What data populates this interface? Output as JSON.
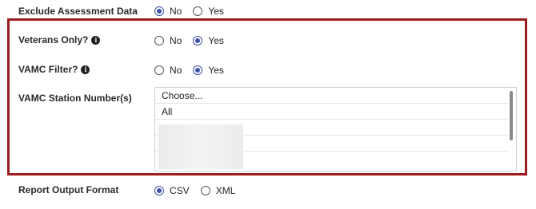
{
  "exclude_assessment": {
    "label": "Exclude Assessment Data",
    "options": [
      "No",
      "Yes"
    ],
    "selected": "No"
  },
  "veterans_only": {
    "label": "Veterans Only?",
    "options": [
      "No",
      "Yes"
    ],
    "selected": "Yes"
  },
  "vamc_filter": {
    "label": "VAMC Filter?",
    "options": [
      "No",
      "Yes"
    ],
    "selected": "Yes"
  },
  "vamc_station": {
    "label": "VAMC Station Number(s)",
    "items": [
      "Choose...",
      "All"
    ]
  },
  "report_output": {
    "label": "Report Output Format",
    "options": [
      "CSV",
      "XML"
    ],
    "selected": "CSV"
  },
  "colors": {
    "highlight_border": "#9b1b1f",
    "radio_selected": "#3b50a8"
  },
  "icons": {
    "info": "info-icon"
  }
}
